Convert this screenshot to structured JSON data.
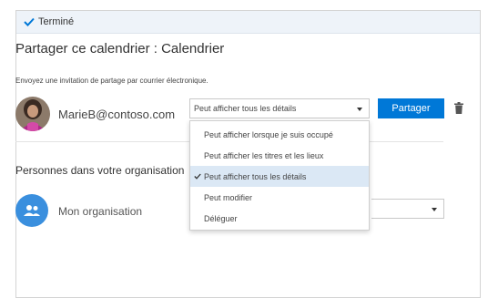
{
  "topbar": {
    "done_label": "Terminé"
  },
  "dialog": {
    "title": "Partager ce calendrier : Calendrier",
    "invite_hint": "Envoyez une invitation de partage par courrier électronique."
  },
  "invite": {
    "email": "MarieB@contoso.com",
    "permission_value": "Peut afficher tous les détails",
    "share_label": "Partager"
  },
  "org_section": {
    "label": "Personnes dans votre organisation",
    "org_name": "Mon organisation"
  },
  "permission_menu": {
    "items": [
      "Peut afficher lorsque je suis occupé",
      "Peut afficher les titres et les lieux",
      "Peut afficher tous les détails",
      "Peut modifier",
      "Déléguer"
    ],
    "selected_index": 2
  },
  "colors": {
    "accent": "#0078d7",
    "topbar": "#eef3f9",
    "selected_item": "#dbe8f5",
    "org_avatar": "#3a8fde"
  },
  "icons": {
    "done": "check-icon",
    "delete": "trash-icon",
    "org": "people-icon",
    "select": "chevron-down-icon"
  }
}
